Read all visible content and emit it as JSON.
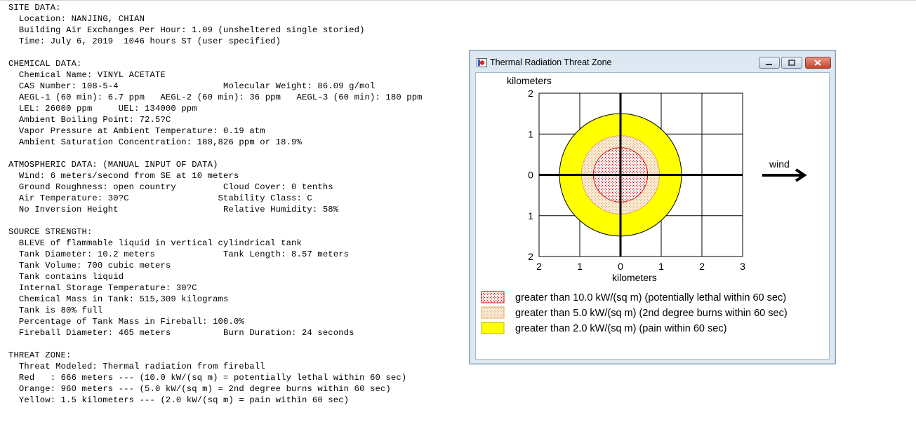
{
  "report_lines": [
    "SITE DATA:",
    "  Location: NANJING, CHIAN",
    "  Building Air Exchanges Per Hour: 1.09 (unsheltered single storied)",
    "  Time: July 6, 2019  1046 hours ST (user specified)",
    "",
    "CHEMICAL DATA:",
    "  Chemical Name: VINYL ACETATE",
    "  CAS Number: 108-5-4                    Molecular Weight: 86.09 g/mol",
    "  AEGL-1 (60 min): 6.7 ppm   AEGL-2 (60 min): 36 ppm   AEGL-3 (60 min): 180 ppm",
    "  LEL: 26000 ppm     UEL: 134000 ppm",
    "  Ambient Boiling Point: 72.5?C",
    "  Vapor Pressure at Ambient Temperature: 0.19 atm",
    "  Ambient Saturation Concentration: 188,826 ppm or 18.9%",
    "",
    "ATMOSPHERIC DATA: (MANUAL INPUT OF DATA)",
    "  Wind: 6 meters/second from SE at 10 meters",
    "  Ground Roughness: open country         Cloud Cover: 0 tenths",
    "  Air Temperature: 30?C                 Stability Class: C",
    "  No Inversion Height                    Relative Humidity: 58%",
    "",
    "SOURCE STRENGTH:",
    "  BLEVE of flammable liquid in vertical cylindrical tank",
    "  Tank Diameter: 10.2 meters             Tank Length: 8.57 meters",
    "  Tank Volume: 700 cubic meters",
    "  Tank contains liquid",
    "  Internal Storage Temperature: 30?C",
    "  Chemical Mass in Tank: 515,309 kilograms",
    "  Tank is 80% full",
    "  Percentage of Tank Mass in Fireball: 100.0%",
    "  Fireball Diameter: 465 meters          Burn Duration: 24 seconds",
    "",
    "THREAT ZONE:",
    "  Threat Modeled: Thermal radiation from fireball",
    "  Red   : 666 meters --- (10.0 kW/(sq m) = potentially lethal within 60 sec)",
    "  Orange: 960 meters --- (5.0 kW/(sq m) = 2nd degree burns within 60 sec)",
    "  Yellow: 1.5 kilometers --- (2.0 kW/(sq m) = pain within 60 sec)"
  ],
  "window": {
    "title": "Thermal Radiation Threat Zone",
    "buttons": [
      "minimize",
      "maximize",
      "close"
    ]
  },
  "chart_data": {
    "type": "threat-zone-map",
    "ylabel": "kilometers",
    "xlabel": "kilometers",
    "x_ticks": [
      "2",
      "1",
      "0",
      "1",
      "2",
      "3"
    ],
    "y_ticks": [
      "2",
      "1",
      "0",
      "1",
      "2"
    ],
    "xlim": [
      -2,
      3
    ],
    "ylim": [
      -2,
      2
    ],
    "zones": [
      {
        "name": "yellow",
        "radius_km": 1.5,
        "color": "#ffff00"
      },
      {
        "name": "orange",
        "radius_km": 0.96,
        "color": "#f6d9b8"
      },
      {
        "name": "red",
        "radius_km": 0.666,
        "color": "#ff0000"
      }
    ],
    "wind_label": "wind",
    "legend": [
      {
        "swatch": "red",
        "text": "greater than 10.0 kW/(sq m) (potentially lethal within 60 sec)"
      },
      {
        "swatch": "orange",
        "text": "greater than 5.0 kW/(sq m) (2nd degree burns within 60 sec)"
      },
      {
        "swatch": "yellow",
        "text": "greater than 2.0 kW/(sq m) (pain within 60 sec)"
      }
    ]
  }
}
